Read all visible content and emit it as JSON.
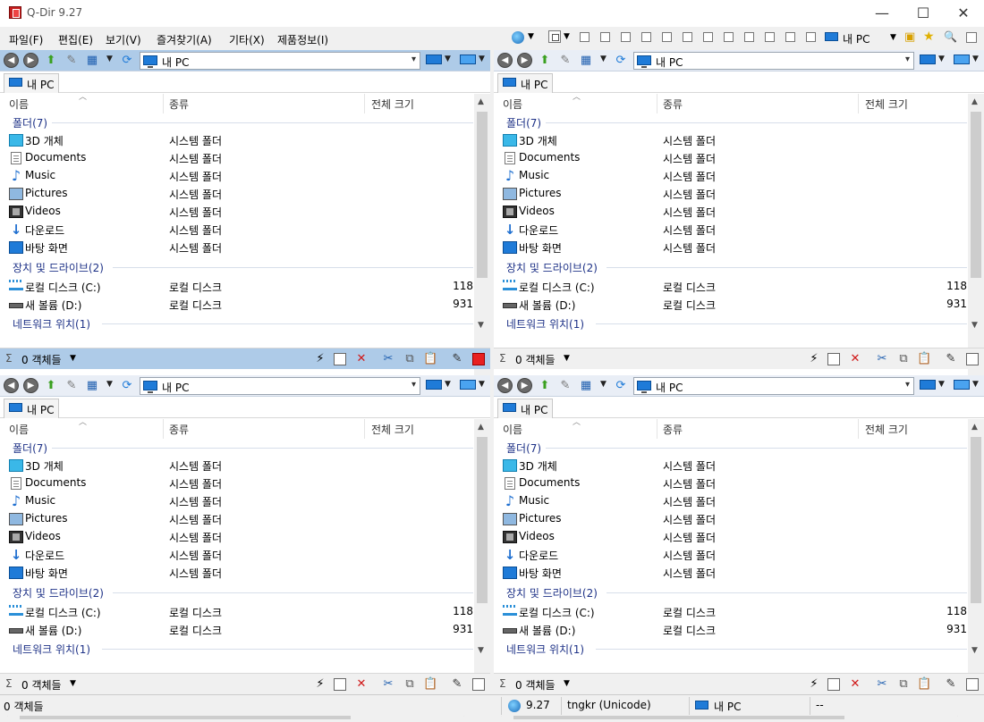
{
  "window": {
    "title": "Q-Dir 9.27",
    "minimize": "—",
    "maximize": "☐",
    "close": "✕"
  },
  "menu": {
    "items": [
      "파일(F)",
      "편집(E)",
      "보기(V)",
      "즐겨찾기(A)",
      "기타(X)",
      "제품정보(I)"
    ],
    "right_location": "내 PC"
  },
  "pane_template": {
    "address": "내 PC",
    "tab_label": "내 PC",
    "columns": [
      "이름",
      "종류",
      "전체 크기"
    ],
    "groups": {
      "folders": "폴더(7)",
      "devices": "장치 및 드라이브(2)",
      "network": "네트워크 위치(1)"
    },
    "folders": [
      {
        "name": "3D 개체",
        "type": "시스템 폴더",
        "icon": "cube-3d-icon"
      },
      {
        "name": "Documents",
        "type": "시스템 폴더",
        "icon": "documents-icon"
      },
      {
        "name": "Music",
        "type": "시스템 폴더",
        "icon": "music-icon"
      },
      {
        "name": "Pictures",
        "type": "시스템 폴더",
        "icon": "pictures-icon"
      },
      {
        "name": "Videos",
        "type": "시스템 폴더",
        "icon": "videos-icon"
      },
      {
        "name": "다운로드",
        "type": "시스템 폴더",
        "icon": "download-icon"
      },
      {
        "name": "바탕 화면",
        "type": "시스템 폴더",
        "icon": "desktop-icon"
      }
    ],
    "drives": [
      {
        "name": "로컬 디스크 (C:)",
        "type": "로컬 디스크",
        "size": "118",
        "icon": "drive-c-icon"
      },
      {
        "name": "새 볼륨 (D:)",
        "type": "로컬 디스크",
        "size": "931",
        "icon": "drive-d-icon"
      }
    ],
    "status_count": "0 객체들"
  },
  "bottom_status": {
    "count": "0 객체들",
    "version": "9.27",
    "language": "tngkr (Unicode)",
    "location": "내 PC",
    "extra": "--"
  },
  "colors": {
    "active_pane": "#aecbe8",
    "group_text": "#1e3287",
    "accent_blue": "#1f7bd8"
  }
}
